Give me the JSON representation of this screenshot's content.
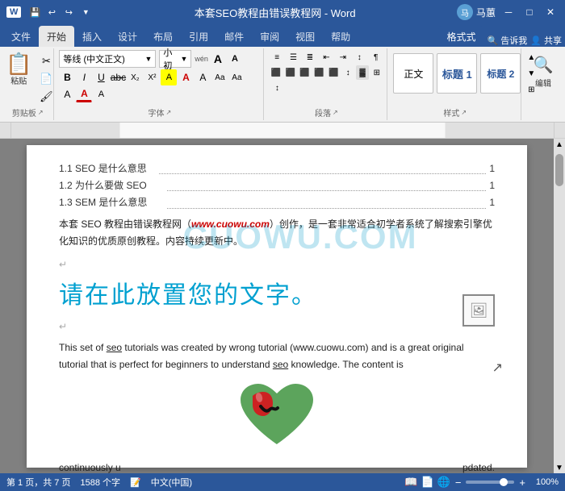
{
  "titlebar": {
    "title": "本套SEO教程由错误教程网 - Word",
    "app_name": "Word",
    "quick_access": [
      "save",
      "undo",
      "redo",
      "customize"
    ],
    "user": "马蕙",
    "window_controls": [
      "minimize",
      "restore",
      "close"
    ]
  },
  "ribbon": {
    "tabs": [
      "文件",
      "开始",
      "插入",
      "设计",
      "布局",
      "引用",
      "邮件",
      "审阅",
      "视图",
      "帮助",
      "格式式"
    ],
    "active_tab": "开始",
    "groups": {
      "clipboard": {
        "label": "剪贴板",
        "paste_label": "粘贴"
      },
      "font": {
        "label": "字体",
        "font_name": "等线 (中文正文)",
        "font_size": "小初",
        "wen_label": "wén",
        "A_label": "A"
      },
      "paragraph": {
        "label": "段落"
      },
      "styles": {
        "label": "样式"
      },
      "editing": {
        "label": "编辑"
      }
    },
    "right_buttons": [
      "告诉我",
      "共享"
    ]
  },
  "document": {
    "toc": [
      {
        "text": "1.1 SEO 是什么意思",
        "dots": "................................................................................",
        "page": "1"
      },
      {
        "text": "1.2 为什么要做 SEO",
        "dots": "...............................................................................",
        "page": "1"
      },
      {
        "text": "1.3 SEM 是什么意思",
        "dots": "...............................................................................",
        "page": "1"
      }
    ],
    "watermark": "CUOWU.COM",
    "intro_text": "本套 SEO 教程由错误教程网（",
    "intro_link": "www.cuowu.com",
    "intro_text2": "）创作，是一套非常适合初学者系统了解搜索引擎优化知识的优质原创教程。内容持续更新中。",
    "placeholder_text": "请在此放置您的文字。",
    "en_text": "This set of seo tutorials was created by wrong tutorial (www.cuowu.com) and is a great original tutorial that is perfect for beginners to understand seo knowledge. The content is",
    "bottom_left": "continuously u",
    "bottom_right": "pdated.",
    "image_icon": "🖼"
  },
  "statusbar": {
    "page_info": "第 1 页，共 7 页",
    "word_count": "1588 个字",
    "track_icon": "📝",
    "language": "中文(中国)",
    "zoom": "100%",
    "view_buttons": [
      "阅读",
      "页面",
      "网页"
    ]
  }
}
